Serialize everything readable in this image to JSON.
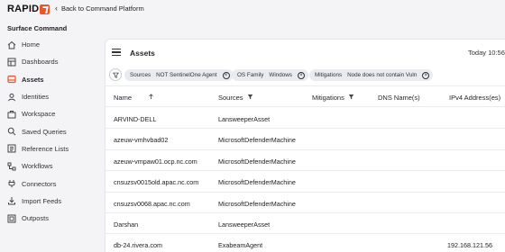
{
  "brand": {
    "logo_text": "RAPID",
    "accent": "#e8562a"
  },
  "topbar": {
    "back_label": "Back to Command Platform"
  },
  "app": {
    "title": "Surface Command"
  },
  "sidebar": {
    "items": [
      {
        "label": "Home",
        "icon": "home-icon"
      },
      {
        "label": "Dashboards",
        "icon": "dashboard-icon"
      },
      {
        "label": "Assets",
        "icon": "assets-icon",
        "active": true
      },
      {
        "label": "Identities",
        "icon": "identity-icon"
      },
      {
        "label": "Workspace",
        "icon": "workspace-icon"
      },
      {
        "label": "Saved Queries",
        "icon": "search-icon"
      },
      {
        "label": "Reference Lists",
        "icon": "list-icon"
      },
      {
        "label": "Workflows",
        "icon": "workflow-icon"
      },
      {
        "label": "Connectors",
        "icon": "connector-icon"
      },
      {
        "label": "Import Feeds",
        "icon": "import-icon"
      },
      {
        "label": "Outposts",
        "icon": "outpost-icon"
      }
    ]
  },
  "main": {
    "title": "Assets",
    "time": "Today 10:56",
    "filters": [
      {
        "key": "Sources",
        "value": "NOT SentinelOne Agent"
      },
      {
        "key": "OS Family",
        "value": "Windows"
      },
      {
        "key": "Mitigations",
        "value": "Node does not contain Vuln"
      }
    ],
    "columns": [
      "Name",
      "Sources",
      "Mitigations",
      "DNS Name(s)",
      "IPv4 Address(es)"
    ],
    "rows": [
      {
        "name": "ARVIND-DELL",
        "source": "LansweeperAsset",
        "ip": ""
      },
      {
        "name": "azeuw-vmhvbad02",
        "source": "MicrosoftDefenderMachine",
        "ip": ""
      },
      {
        "name": "azeuw-vmpaw01.ocp.nc.com",
        "source": "MicrosoftDefenderMachine",
        "ip": ""
      },
      {
        "name": "cnsuzsv0015old.apac.nc.com",
        "source": "MicrosoftDefenderMachine",
        "ip": ""
      },
      {
        "name": "cnsuzsv0068.apac.nc.com",
        "source": "MicrosoftDefenderMachine",
        "ip": ""
      },
      {
        "name": "Darshan",
        "source": "LansweeperAsset",
        "ip": ""
      },
      {
        "name": "db-24.rivera.com",
        "source": "ExabeamAgent",
        "ip": "192.168.121.56"
      }
    ]
  }
}
